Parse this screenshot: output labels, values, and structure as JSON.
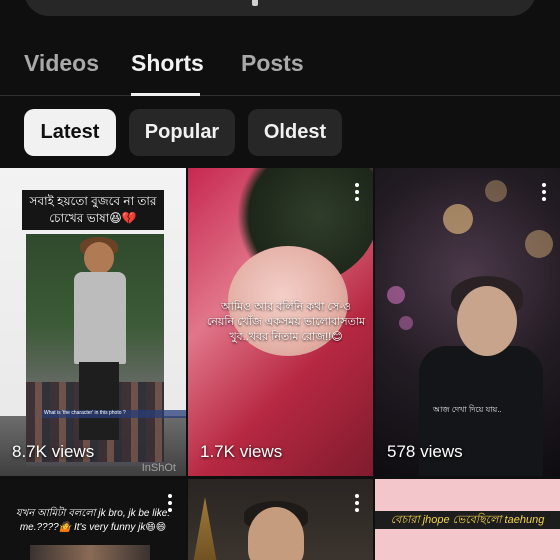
{
  "tabs": [
    {
      "label": "Videos",
      "active": false
    },
    {
      "label": "Shorts",
      "active": true
    },
    {
      "label": "Posts",
      "active": false
    }
  ],
  "filters": [
    {
      "label": "Latest",
      "selected": true
    },
    {
      "label": "Popular",
      "selected": false
    },
    {
      "label": "Oldest",
      "selected": false
    }
  ],
  "shorts": [
    {
      "views": "8.7K views",
      "caption": "সবাই হয়তো বুজবে না তার চোখের ভাষা😆",
      "caption_heart": "💔",
      "inner_text": "What is 'the character' in this photo ?",
      "watermark": "InShOt"
    },
    {
      "views": "1.7K views",
      "caption": "আমিও আর বলিনি কথা সে-ও নেয়নি খোঁজ একসময় ভালোবাসতাম খুব..খবর নিতাম রোজ!!😊"
    },
    {
      "views": "578 views",
      "caption": "আজ দেখা দিয়ে যায়.."
    },
    {
      "views": "",
      "caption": "যখন আমিটা বললো jk bro, jk be like: me.????🤷 It's very funny jk😄😄"
    },
    {
      "views": "",
      "caption": ""
    },
    {
      "views": "",
      "caption": "বেচারা jhope ভেবেছিলো taehung"
    }
  ],
  "colors": {
    "background": "#0f0f0f",
    "chip_selected_bg": "#f1f1f1",
    "chip_bg": "#272727",
    "tab_inactive": "#a9a9a9"
  }
}
